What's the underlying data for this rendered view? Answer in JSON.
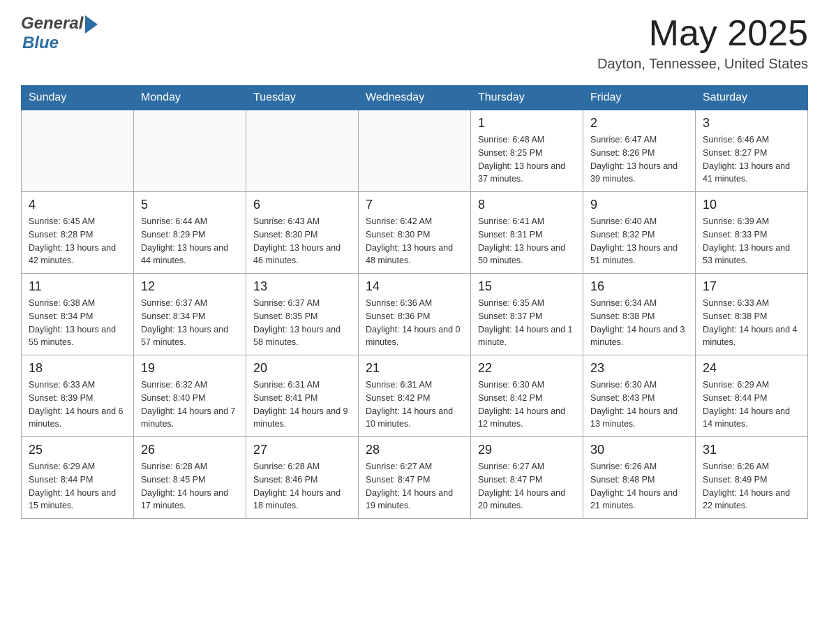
{
  "header": {
    "logo_general": "General",
    "logo_blue": "Blue",
    "month_title": "May 2025",
    "location": "Dayton, Tennessee, United States"
  },
  "days_of_week": [
    "Sunday",
    "Monday",
    "Tuesday",
    "Wednesday",
    "Thursday",
    "Friday",
    "Saturday"
  ],
  "weeks": [
    [
      {
        "day": "",
        "sunrise": "",
        "sunset": "",
        "daylight": ""
      },
      {
        "day": "",
        "sunrise": "",
        "sunset": "",
        "daylight": ""
      },
      {
        "day": "",
        "sunrise": "",
        "sunset": "",
        "daylight": ""
      },
      {
        "day": "",
        "sunrise": "",
        "sunset": "",
        "daylight": ""
      },
      {
        "day": "1",
        "sunrise": "Sunrise: 6:48 AM",
        "sunset": "Sunset: 8:25 PM",
        "daylight": "Daylight: 13 hours and 37 minutes."
      },
      {
        "day": "2",
        "sunrise": "Sunrise: 6:47 AM",
        "sunset": "Sunset: 8:26 PM",
        "daylight": "Daylight: 13 hours and 39 minutes."
      },
      {
        "day": "3",
        "sunrise": "Sunrise: 6:46 AM",
        "sunset": "Sunset: 8:27 PM",
        "daylight": "Daylight: 13 hours and 41 minutes."
      }
    ],
    [
      {
        "day": "4",
        "sunrise": "Sunrise: 6:45 AM",
        "sunset": "Sunset: 8:28 PM",
        "daylight": "Daylight: 13 hours and 42 minutes."
      },
      {
        "day": "5",
        "sunrise": "Sunrise: 6:44 AM",
        "sunset": "Sunset: 8:29 PM",
        "daylight": "Daylight: 13 hours and 44 minutes."
      },
      {
        "day": "6",
        "sunrise": "Sunrise: 6:43 AM",
        "sunset": "Sunset: 8:30 PM",
        "daylight": "Daylight: 13 hours and 46 minutes."
      },
      {
        "day": "7",
        "sunrise": "Sunrise: 6:42 AM",
        "sunset": "Sunset: 8:30 PM",
        "daylight": "Daylight: 13 hours and 48 minutes."
      },
      {
        "day": "8",
        "sunrise": "Sunrise: 6:41 AM",
        "sunset": "Sunset: 8:31 PM",
        "daylight": "Daylight: 13 hours and 50 minutes."
      },
      {
        "day": "9",
        "sunrise": "Sunrise: 6:40 AM",
        "sunset": "Sunset: 8:32 PM",
        "daylight": "Daylight: 13 hours and 51 minutes."
      },
      {
        "day": "10",
        "sunrise": "Sunrise: 6:39 AM",
        "sunset": "Sunset: 8:33 PM",
        "daylight": "Daylight: 13 hours and 53 minutes."
      }
    ],
    [
      {
        "day": "11",
        "sunrise": "Sunrise: 6:38 AM",
        "sunset": "Sunset: 8:34 PM",
        "daylight": "Daylight: 13 hours and 55 minutes."
      },
      {
        "day": "12",
        "sunrise": "Sunrise: 6:37 AM",
        "sunset": "Sunset: 8:34 PM",
        "daylight": "Daylight: 13 hours and 57 minutes."
      },
      {
        "day": "13",
        "sunrise": "Sunrise: 6:37 AM",
        "sunset": "Sunset: 8:35 PM",
        "daylight": "Daylight: 13 hours and 58 minutes."
      },
      {
        "day": "14",
        "sunrise": "Sunrise: 6:36 AM",
        "sunset": "Sunset: 8:36 PM",
        "daylight": "Daylight: 14 hours and 0 minutes."
      },
      {
        "day": "15",
        "sunrise": "Sunrise: 6:35 AM",
        "sunset": "Sunset: 8:37 PM",
        "daylight": "Daylight: 14 hours and 1 minute."
      },
      {
        "day": "16",
        "sunrise": "Sunrise: 6:34 AM",
        "sunset": "Sunset: 8:38 PM",
        "daylight": "Daylight: 14 hours and 3 minutes."
      },
      {
        "day": "17",
        "sunrise": "Sunrise: 6:33 AM",
        "sunset": "Sunset: 8:38 PM",
        "daylight": "Daylight: 14 hours and 4 minutes."
      }
    ],
    [
      {
        "day": "18",
        "sunrise": "Sunrise: 6:33 AM",
        "sunset": "Sunset: 8:39 PM",
        "daylight": "Daylight: 14 hours and 6 minutes."
      },
      {
        "day": "19",
        "sunrise": "Sunrise: 6:32 AM",
        "sunset": "Sunset: 8:40 PM",
        "daylight": "Daylight: 14 hours and 7 minutes."
      },
      {
        "day": "20",
        "sunrise": "Sunrise: 6:31 AM",
        "sunset": "Sunset: 8:41 PM",
        "daylight": "Daylight: 14 hours and 9 minutes."
      },
      {
        "day": "21",
        "sunrise": "Sunrise: 6:31 AM",
        "sunset": "Sunset: 8:42 PM",
        "daylight": "Daylight: 14 hours and 10 minutes."
      },
      {
        "day": "22",
        "sunrise": "Sunrise: 6:30 AM",
        "sunset": "Sunset: 8:42 PM",
        "daylight": "Daylight: 14 hours and 12 minutes."
      },
      {
        "day": "23",
        "sunrise": "Sunrise: 6:30 AM",
        "sunset": "Sunset: 8:43 PM",
        "daylight": "Daylight: 14 hours and 13 minutes."
      },
      {
        "day": "24",
        "sunrise": "Sunrise: 6:29 AM",
        "sunset": "Sunset: 8:44 PM",
        "daylight": "Daylight: 14 hours and 14 minutes."
      }
    ],
    [
      {
        "day": "25",
        "sunrise": "Sunrise: 6:29 AM",
        "sunset": "Sunset: 8:44 PM",
        "daylight": "Daylight: 14 hours and 15 minutes."
      },
      {
        "day": "26",
        "sunrise": "Sunrise: 6:28 AM",
        "sunset": "Sunset: 8:45 PM",
        "daylight": "Daylight: 14 hours and 17 minutes."
      },
      {
        "day": "27",
        "sunrise": "Sunrise: 6:28 AM",
        "sunset": "Sunset: 8:46 PM",
        "daylight": "Daylight: 14 hours and 18 minutes."
      },
      {
        "day": "28",
        "sunrise": "Sunrise: 6:27 AM",
        "sunset": "Sunset: 8:47 PM",
        "daylight": "Daylight: 14 hours and 19 minutes."
      },
      {
        "day": "29",
        "sunrise": "Sunrise: 6:27 AM",
        "sunset": "Sunset: 8:47 PM",
        "daylight": "Daylight: 14 hours and 20 minutes."
      },
      {
        "day": "30",
        "sunrise": "Sunrise: 6:26 AM",
        "sunset": "Sunset: 8:48 PM",
        "daylight": "Daylight: 14 hours and 21 minutes."
      },
      {
        "day": "31",
        "sunrise": "Sunrise: 6:26 AM",
        "sunset": "Sunset: 8:49 PM",
        "daylight": "Daylight: 14 hours and 22 minutes."
      }
    ]
  ]
}
